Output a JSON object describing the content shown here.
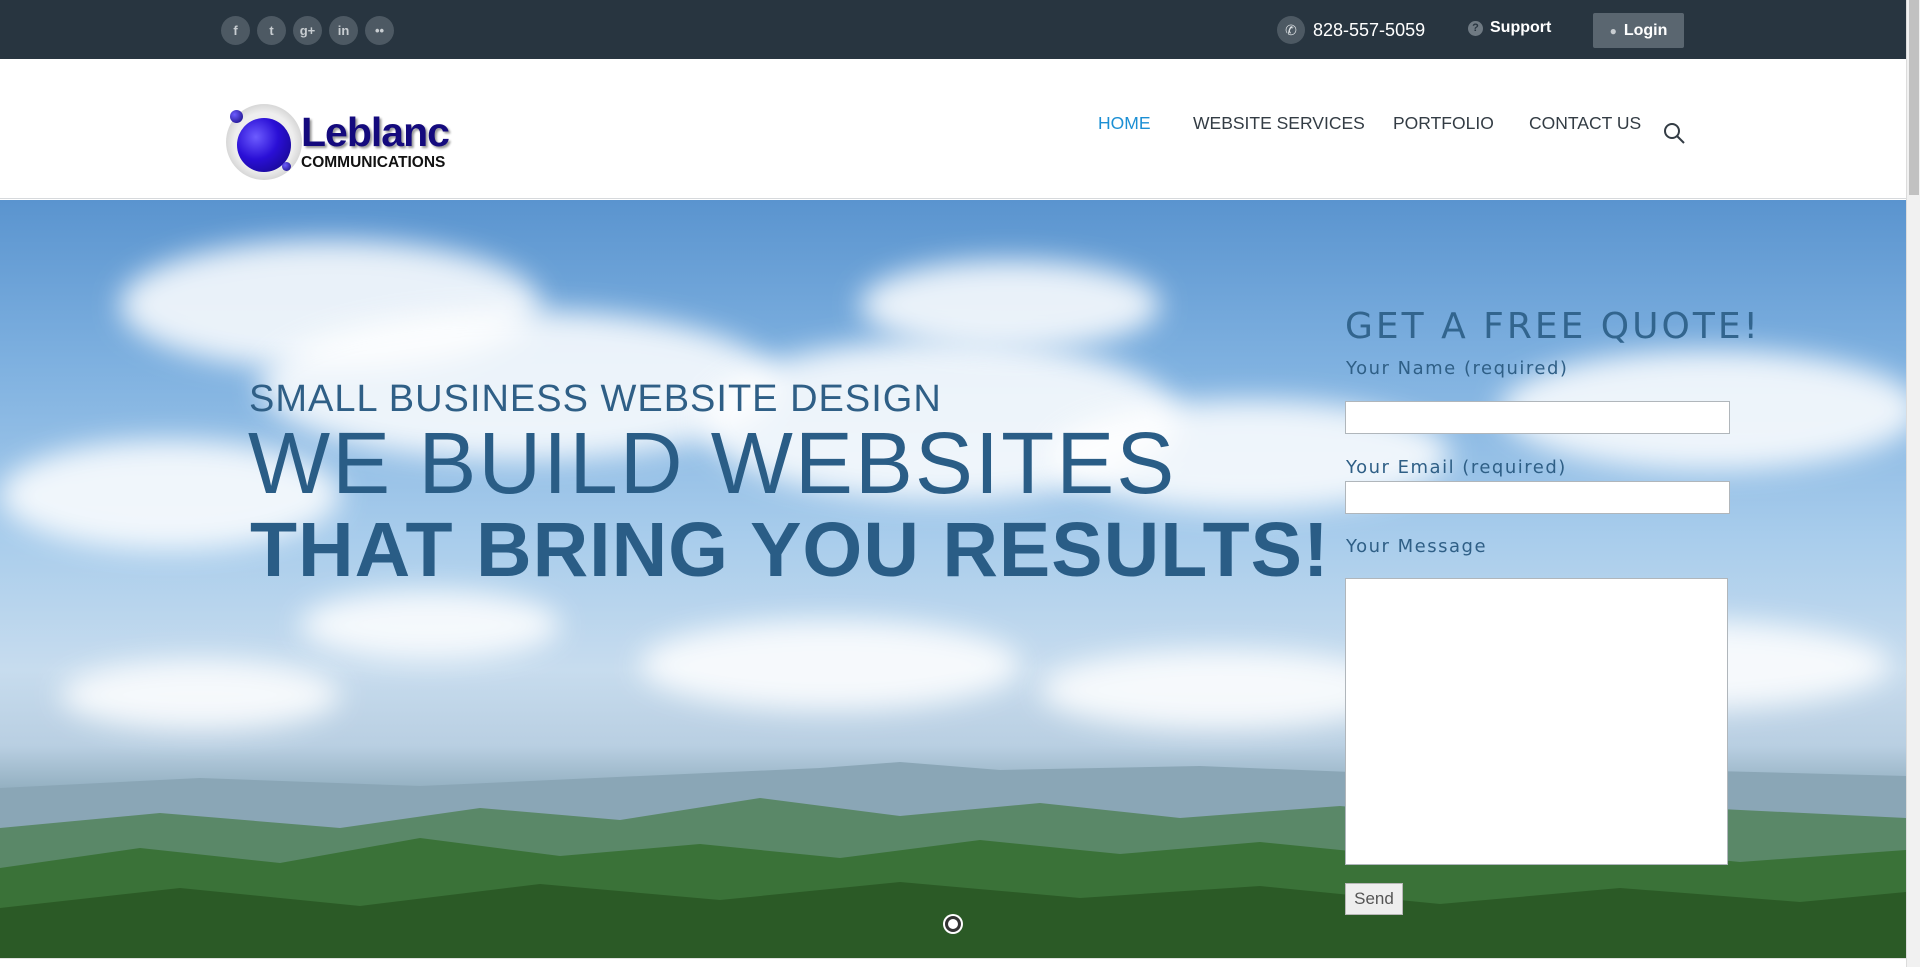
{
  "topbar": {
    "social": [
      {
        "icon": "facebook-icon",
        "glyph": "f"
      },
      {
        "icon": "twitter-icon",
        "glyph": "t"
      },
      {
        "icon": "google-plus-icon",
        "glyph": "g+"
      },
      {
        "icon": "linkedin-icon",
        "glyph": "in"
      },
      {
        "icon": "flickr-icon",
        "glyph": "••"
      }
    ],
    "phone": "828-557-5059",
    "support_label": "Support",
    "login_label": "Login"
  },
  "header": {
    "logo_brand": "Leblanc",
    "logo_sub": "COMMUNICATIONS",
    "nav": [
      {
        "label": "HOME",
        "active": true
      },
      {
        "label": "WEBSITE SERVICES",
        "active": false
      },
      {
        "label": "PORTFOLIO",
        "active": false
      },
      {
        "label": "CONTACT US",
        "active": false
      }
    ]
  },
  "hero": {
    "kicker": "SMALL BUSINESS WEBSITE DESIGN",
    "headline_1": "WE BUILD WEBSITES",
    "headline_2": "THAT BRING YOU RESULTS!"
  },
  "quote_form": {
    "title": "GET A FREE QUOTE!",
    "name_label": "Your Name (required)",
    "name_value": "",
    "email_label": "Your Email (required)",
    "email_value": "",
    "message_label": "Your Message",
    "message_value": "",
    "send_label": "Send"
  },
  "colors": {
    "topbar_bg": "#283540",
    "nav_active": "#1b8fd4",
    "hero_text": "#2a5d86"
  }
}
